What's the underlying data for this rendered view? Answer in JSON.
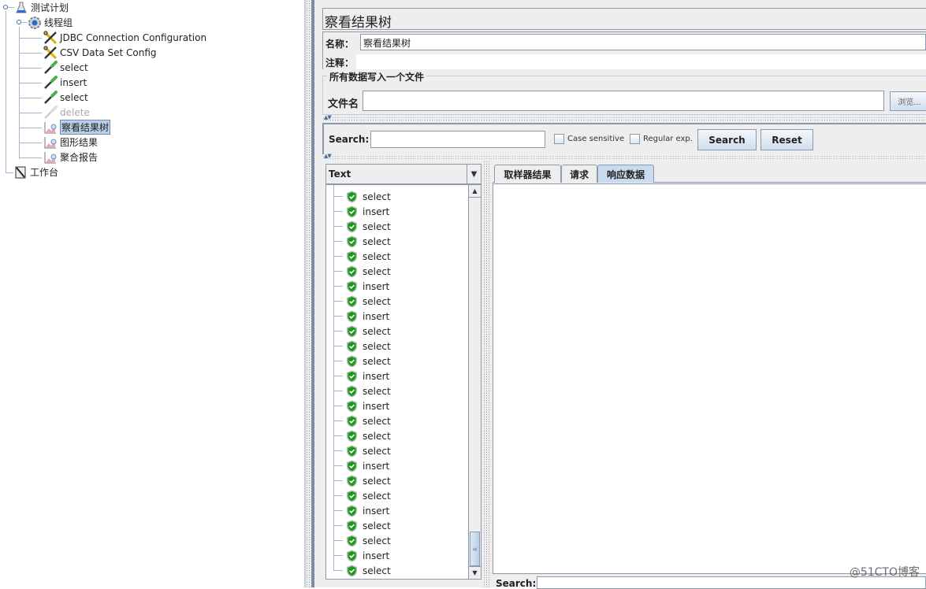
{
  "tree": {
    "nodes": [
      {
        "label": "测试计划",
        "icon": "test-plan-flask-icon",
        "state": "normal"
      },
      {
        "label": "线程组",
        "icon": "thread-group-gear-icon",
        "state": "normal"
      },
      {
        "label": "JDBC Connection Configuration",
        "icon": "config-wrench-icon",
        "state": "normal"
      },
      {
        "label": "CSV Data Set Config",
        "icon": "config-wrench-icon",
        "state": "normal"
      },
      {
        "label": "select",
        "icon": "sampler-pipette-icon",
        "state": "normal"
      },
      {
        "label": "insert",
        "icon": "sampler-pipette-icon",
        "state": "normal"
      },
      {
        "label": "select",
        "icon": "sampler-pipette-icon",
        "state": "normal"
      },
      {
        "label": "delete",
        "icon": "sampler-pipette-icon",
        "state": "disabled"
      },
      {
        "label": "察看结果树",
        "icon": "listener-graph-icon",
        "state": "selected"
      },
      {
        "label": "图形结果",
        "icon": "listener-graph-icon",
        "state": "normal"
      },
      {
        "label": "聚合报告",
        "icon": "listener-graph-icon",
        "state": "normal"
      },
      {
        "label": "工作台",
        "icon": "workbench-notepad-icon",
        "state": "normal"
      }
    ]
  },
  "panel": {
    "title": "察看结果树",
    "name_label": "名称：",
    "name_value": "察看结果树",
    "comment_label": "注释：",
    "comment_value": "",
    "file_group_label": "所有数据写入一个文件",
    "filename_label": "文件名",
    "filename_value": "",
    "browse_label": "浏览..."
  },
  "search": {
    "label": "Search:",
    "value": "",
    "case_sensitive_label": "Case sensitive",
    "case_sensitive_checked": false,
    "regex_label": "Regular exp.",
    "regex_checked": false,
    "search_button": "Search",
    "reset_button": "Reset"
  },
  "results": {
    "renderer": "Text",
    "items": [
      "select",
      "insert",
      "select",
      "select",
      "select",
      "select",
      "insert",
      "select",
      "insert",
      "select",
      "select",
      "select",
      "insert",
      "select",
      "insert",
      "select",
      "select",
      "select",
      "insert",
      "select",
      "select",
      "insert",
      "select",
      "select",
      "insert",
      "select"
    ],
    "status": "success"
  },
  "tabs": [
    {
      "label": "取样器结果",
      "active": false
    },
    {
      "label": "请求",
      "active": false
    },
    {
      "label": "响应数据",
      "active": true
    }
  ],
  "bottom_search_label": "Search:",
  "watermark": "@51CTO博客"
}
